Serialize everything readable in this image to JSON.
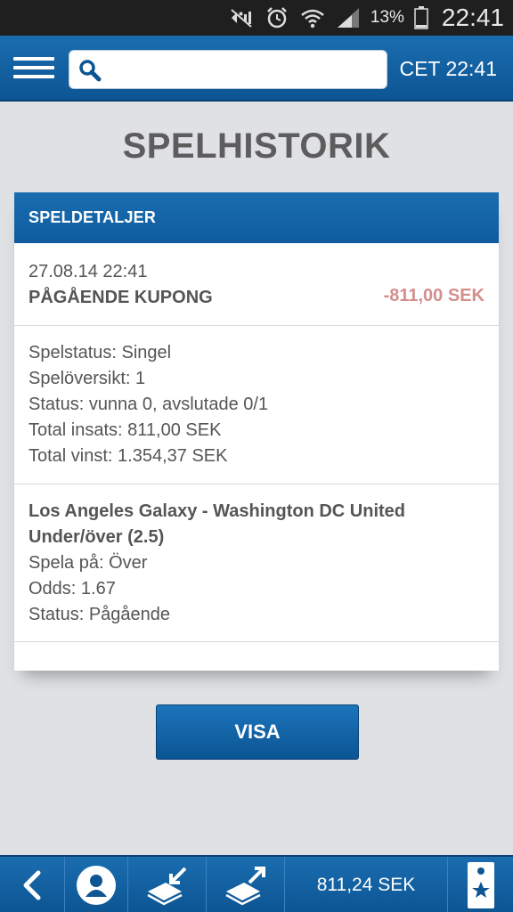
{
  "status_bar": {
    "battery_percent": "13%",
    "time": "22:41"
  },
  "header": {
    "search": {
      "value": "",
      "placeholder": ""
    },
    "server_time": "CET 22:41"
  },
  "page_title": "SPELHISTORIK",
  "card": {
    "title": "SPELDETALJER",
    "summary": {
      "datetime": "27.08.14 22:41",
      "kupong_label": "PÅGÅENDE KUPONG",
      "amount": "-811,00 SEK"
    },
    "details": [
      "Spelstatus: Singel",
      "Spelöversikt: 1",
      "Status: vunna 0, avslutade 0/1",
      "Total insats: 811,00 SEK",
      "Total vinst: 1.354,37 SEK"
    ],
    "bet": {
      "match": "Los Angeles Galaxy - Washington DC United",
      "market": "Under/över (2.5)",
      "pick": "Spela på: Över",
      "odds": "Odds: 1.67",
      "status": "Status: Pågående"
    }
  },
  "visa_button_label": "VISA",
  "bottom_bar": {
    "balance": "811,24 SEK"
  },
  "colors": {
    "primary_blue": "#0f5fa1",
    "negative_amount": "#d48e8e",
    "background": "#dfe1e5"
  },
  "icons": [
    "mute-icon",
    "alarm-icon",
    "wifi-icon",
    "signal-icon",
    "battery-icon",
    "menu-icon",
    "search-icon",
    "back-icon",
    "profile-icon",
    "withdraw-icon",
    "deposit-icon",
    "bet-slip-icon"
  ]
}
